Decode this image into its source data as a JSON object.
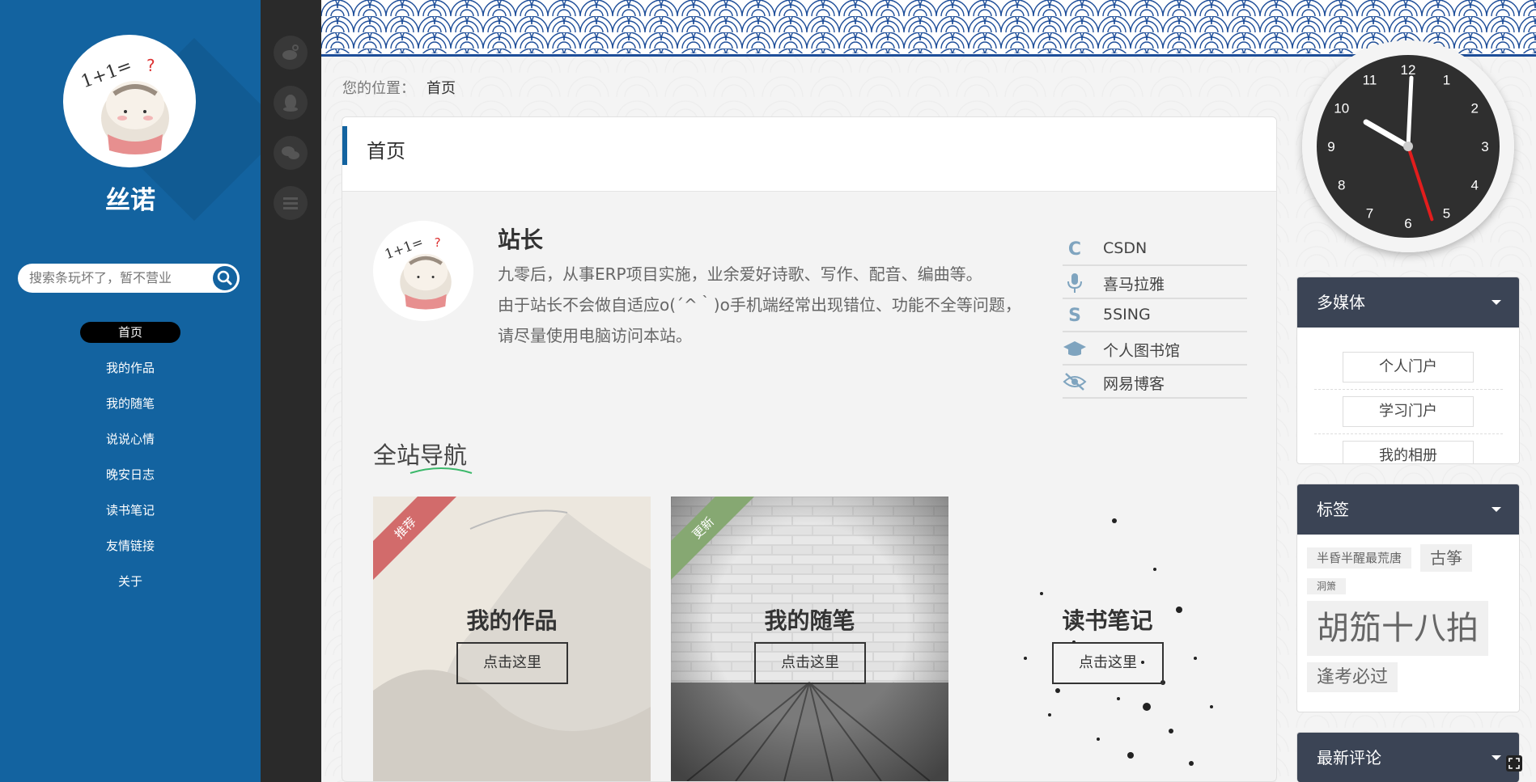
{
  "sidebar": {
    "site_name": "丝诺",
    "search_placeholder": "搜索条玩坏了，暂不营业",
    "nav": [
      "首页",
      "我的作品",
      "我的随笔",
      "说说心情",
      "晚安日志",
      "读书笔记",
      "友情链接",
      "关于"
    ],
    "active_nav": "首页"
  },
  "strip": {
    "icons": [
      "weibo-icon",
      "qq-icon",
      "wechat-icon",
      "list-icon"
    ]
  },
  "breadcrumb": {
    "prefix": "您的位置：",
    "current": "首页"
  },
  "card": {
    "title": "首页",
    "profile": {
      "name": "站长",
      "desc1": "九零后，从事ERP项目实施，业余爱好诗歌、写作、配音、编曲等。",
      "desc2": "由于站长不会做自适应o(´^｀)o手机端经常出现错位、功能不全等问题，",
      "desc3": "请尽量使用电脑访问本站。"
    },
    "links": [
      {
        "label": "CSDN",
        "icon": "csdn-icon",
        "glyph": "C"
      },
      {
        "label": "喜马拉雅",
        "icon": "microphone-icon",
        "glyph": "🎙"
      },
      {
        "label": "5SING",
        "icon": "5sing-icon",
        "glyph": "S"
      },
      {
        "label": "个人图书馆",
        "icon": "graduation-cap-icon",
        "glyph": "🎓"
      },
      {
        "label": "网易博客",
        "icon": "eye-slash-icon",
        "glyph": "◎"
      }
    ],
    "section_title": "全站导航",
    "tiles": [
      {
        "title": "我的作品",
        "button": "点击这里",
        "ribbon": "推荐",
        "ribbon_color": "#d26b6b"
      },
      {
        "title": "我的随笔",
        "button": "点击这里",
        "ribbon": "更新",
        "ribbon_color": "#86a872"
      },
      {
        "title": "读书笔记",
        "button": "点击这里"
      }
    ]
  },
  "widgets": {
    "media": {
      "title": "多媒体",
      "items": [
        "个人门户",
        "学习门户",
        "我的相册"
      ]
    },
    "tags": {
      "title": "标签",
      "items": [
        {
          "label": "半昏半醒最荒唐",
          "size": 15
        },
        {
          "label": "古筝",
          "size": 20
        },
        {
          "label": "洞箫",
          "size": 12
        },
        {
          "label": "胡笳十八拍",
          "size": 40
        },
        {
          "label": "逢考必过",
          "size": 22
        }
      ]
    },
    "comments": {
      "title": "最新评论"
    }
  },
  "clock": {
    "hour": 10,
    "minute": 0,
    "second": 27,
    "numbers": [
      "12",
      "1",
      "2",
      "3",
      "4",
      "5",
      "6",
      "7",
      "8",
      "9",
      "10",
      "11"
    ]
  },
  "colors": {
    "sidebar": "#1363a0",
    "strip": "#2a2a2a",
    "widget_head": "#3b4455",
    "accent": "#1363a0"
  }
}
